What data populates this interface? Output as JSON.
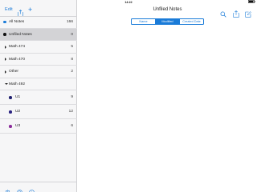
{
  "status_bar": {
    "device": "iPad",
    "time": "14:22",
    "battery": "▮▮▯"
  },
  "sidebar": {
    "toolbar": {
      "edit_label": "Edit",
      "add_icon": "+"
    },
    "notebooks": [
      {
        "label": "All Notes",
        "count": "166",
        "color": "#1a7bd8",
        "marker": "dot"
      },
      {
        "label": "Unfiled Notes",
        "count": "0",
        "color": "#111111",
        "marker": "dot",
        "selected": true
      },
      {
        "label": "Math 474",
        "count": "5",
        "marker": "arrow-right"
      },
      {
        "label": "Math 470",
        "count": "8",
        "marker": "arrow-right"
      },
      {
        "label": "Other",
        "count": "2",
        "marker": "arrow-right"
      },
      {
        "label": "Math 492",
        "count": "",
        "marker": "arrow-down"
      },
      {
        "label": "U1",
        "count": "9",
        "color": "#1f1f6e",
        "marker": "dot",
        "indent": true
      },
      {
        "label": "U2",
        "count": "12",
        "color": "#2a2280",
        "marker": "dot",
        "indent": true
      },
      {
        "label": "U3",
        "count": "6",
        "color": "#8a2a9a",
        "marker": "dot",
        "indent": true
      }
    ],
    "bottom_icons": [
      "gear-icon",
      "help-icon",
      "info-icon"
    ]
  },
  "main": {
    "title": "Unfiled Notes",
    "sort_tabs": [
      {
        "label": "Name",
        "active": false
      },
      {
        "label": "Modified Date",
        "active": true
      },
      {
        "label": "Created Date",
        "active": false
      }
    ],
    "toolbar_icons": [
      "search-icon",
      "export-icon",
      "compose-icon"
    ]
  },
  "colors": {
    "accent": "#1a7bd8",
    "selected_row": "#d3d3d6",
    "sidebar_bg": "#f6f6f7"
  }
}
